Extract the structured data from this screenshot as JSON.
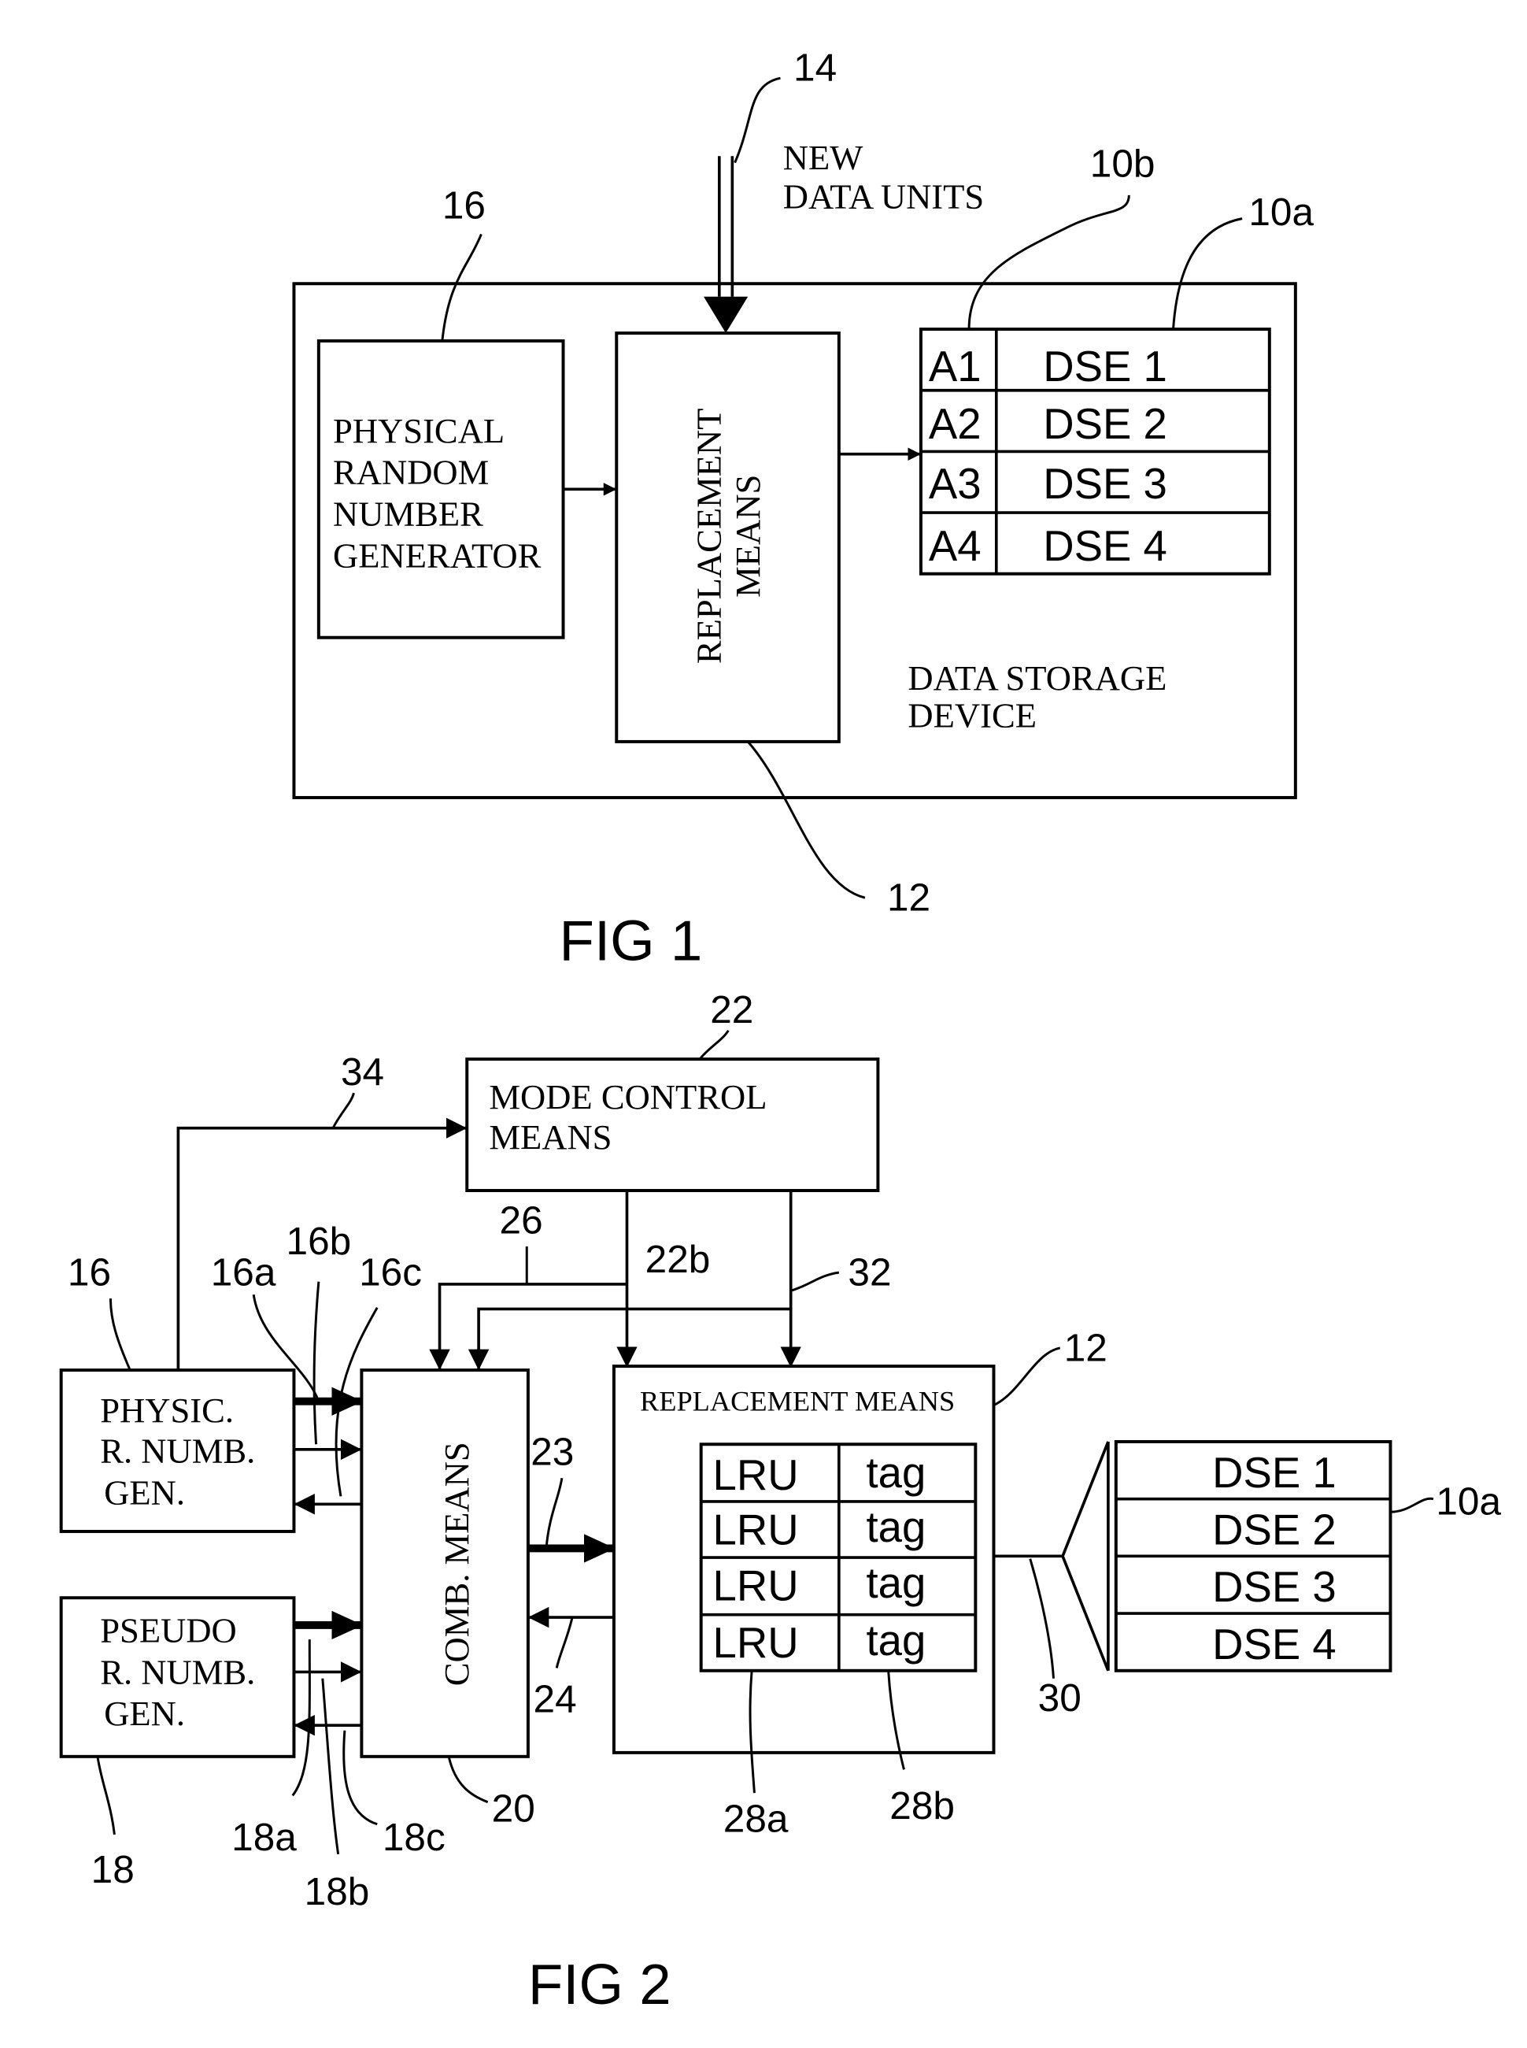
{
  "fig1": {
    "caption": "FIG 1",
    "refs": {
      "r14": "14",
      "r16": "16",
      "r10b": "10b",
      "r10a": "10a",
      "r12": "12"
    },
    "input_label": [
      "NEW",
      "DATA UNITS"
    ],
    "prng_box": [
      "PHYSICAL",
      "RANDOM",
      "NUMBER",
      "GENERATOR"
    ],
    "replacement_box": [
      "REPLACEMENT",
      "MEANS"
    ],
    "device_label": [
      "DATA STORAGE",
      "DEVICE"
    ],
    "table": [
      {
        "addr": "A1",
        "dse": "DSE 1"
      },
      {
        "addr": "A2",
        "dse": "DSE 2"
      },
      {
        "addr": "A3",
        "dse": "DSE 3"
      },
      {
        "addr": "A4",
        "dse": "DSE 4"
      }
    ]
  },
  "fig2": {
    "caption": "FIG 2",
    "refs": {
      "r22": "22",
      "r34": "34",
      "r26": "26",
      "r22b": "22b",
      "r32": "32",
      "r16": "16",
      "r16a": "16a",
      "r16b": "16b",
      "r16c": "16c",
      "r12": "12",
      "r23": "23",
      "r24": "24",
      "r10a": "10a",
      "r30": "30",
      "r18": "18",
      "r18a": "18a",
      "r18b": "18b",
      "r18c": "18c",
      "r20": "20",
      "r28a": "28a",
      "r28b": "28b"
    },
    "mode_control": [
      "MODE CONTROL",
      "MEANS"
    ],
    "physic_gen": [
      "PHYSIC.",
      "R. NUMB.",
      "GEN."
    ],
    "pseudo_gen": [
      "PSEUDO",
      "R. NUMB.",
      "GEN."
    ],
    "comb_means": "COMB. MEANS",
    "replacement_title": "REPLACEMENT MEANS",
    "lru_table": [
      {
        "lru": "LRU",
        "tag": "tag"
      },
      {
        "lru": "LRU",
        "tag": "tag"
      },
      {
        "lru": "LRU",
        "tag": "tag"
      },
      {
        "lru": "LRU",
        "tag": "tag"
      }
    ],
    "dse_table": [
      "DSE 1",
      "DSE 2",
      "DSE 3",
      "DSE 4"
    ]
  }
}
